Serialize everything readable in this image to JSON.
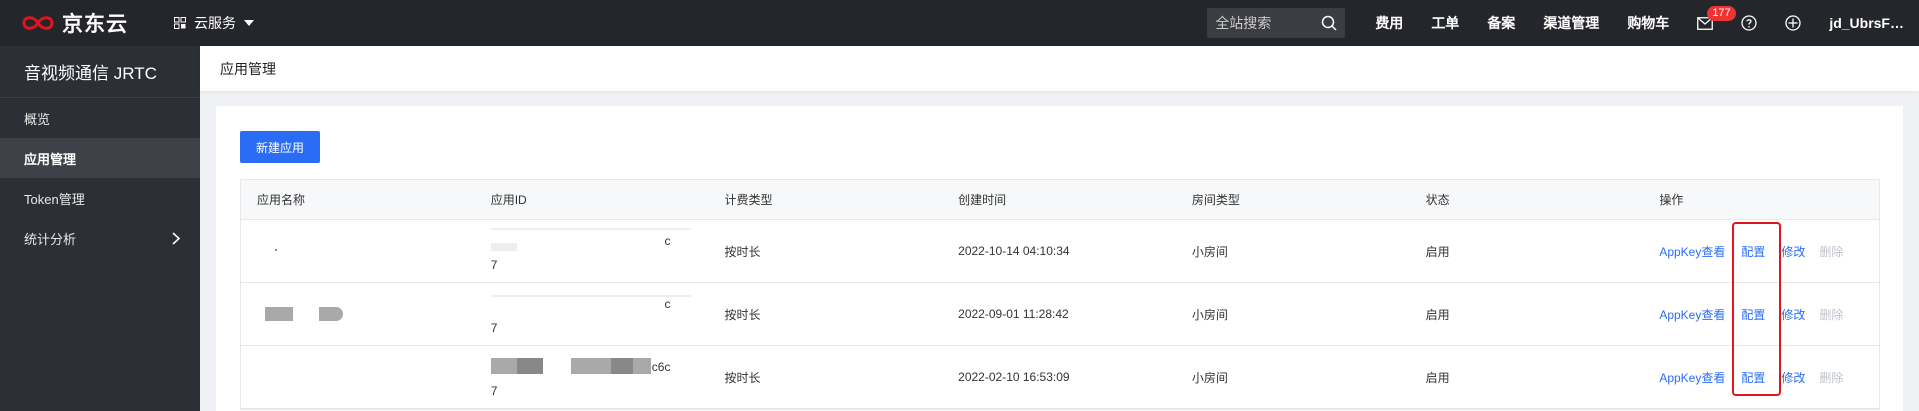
{
  "topbar": {
    "brand": "京东云",
    "cloud_services": "云服务",
    "search_placeholder": "全站搜索",
    "nav": [
      "费用",
      "工单",
      "备案",
      "渠道管理",
      "购物车"
    ],
    "message_count": "177",
    "user": "jd_UbrsF…",
    "icons": [
      "jd-cloud-logo-icon",
      "grid-icon",
      "search-icon",
      "mail-icon",
      "help-icon",
      "globe-icon"
    ]
  },
  "sidebar": {
    "title": "音视频通信 JRTC",
    "items": [
      {
        "label": "概览"
      },
      {
        "label": "应用管理"
      },
      {
        "label": "Token管理"
      },
      {
        "label": "统计分析"
      }
    ]
  },
  "header": {
    "title": "应用管理"
  },
  "main": {
    "new_button": "新建应用",
    "columns": [
      "应用名称",
      "应用ID",
      "计费类型",
      "创建时间",
      "房间类型",
      "状态",
      "操作"
    ],
    "rows": [
      {
        "id_suffix": "c",
        "id_tail": "7",
        "billing": "按时长",
        "created": "2022-10-14 04:10:34",
        "room": "小房间",
        "status": "启用"
      },
      {
        "id_suffix": "c",
        "id_tail": "7",
        "billing": "按时长",
        "created": "2022-09-01 11:28:42",
        "room": "小房间",
        "status": "启用"
      },
      {
        "id_suffix": "c6c",
        "id_tail": "7",
        "billing": "按时长",
        "created": "2022-02-10 16:53:09",
        "room": "小房间",
        "status": "启用"
      }
    ],
    "actions": {
      "view_key": "AppKey查看",
      "config": "配置",
      "modify": "修改",
      "delete": "删除"
    }
  },
  "colors": {
    "topbar": "#24262b",
    "sidebar": "#2c2f35",
    "primary": "#2a6df4",
    "highlight": "#e3141c"
  }
}
